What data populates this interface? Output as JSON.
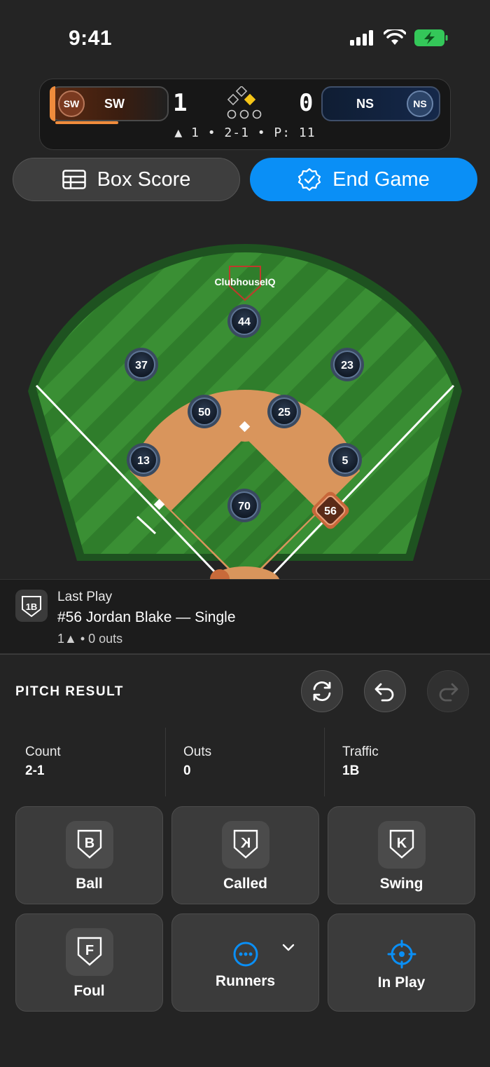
{
  "status_bar": {
    "time": "9:41"
  },
  "scoreboard": {
    "away": {
      "badge": "SW",
      "abbr": "SW",
      "score": "1"
    },
    "home": {
      "badge": "NS",
      "abbr": "NS",
      "score": "0"
    },
    "inning_line": "▲ 1 • 2-1 • P: 11"
  },
  "actions": {
    "box_score": "Box Score",
    "end_game": "End Game"
  },
  "field": {
    "brand": "ClubhouseIQ",
    "fielders": [
      "44",
      "37",
      "23",
      "50",
      "25",
      "13",
      "5",
      "70"
    ],
    "runner": "56"
  },
  "last_play": {
    "icon_label": "1B",
    "title": "Last Play",
    "description": "#56 Jordan Blake — Single",
    "detail": "1▲ • 0 outs"
  },
  "pitch_result": {
    "title": "PITCH RESULT",
    "stats": [
      {
        "label": "Count",
        "value": "2-1"
      },
      {
        "label": "Outs",
        "value": "0"
      },
      {
        "label": "Traffic",
        "value": "1B"
      }
    ],
    "buttons": {
      "ball": "Ball",
      "called": "Called",
      "swing": "Swing",
      "foul": "Foul",
      "runners": "Runners",
      "in_play": "In Play"
    }
  },
  "colors": {
    "accent": "#0a8ff6",
    "away": "#f08c3c",
    "infield": "#d9955c",
    "grass": "#2f7d2b"
  }
}
